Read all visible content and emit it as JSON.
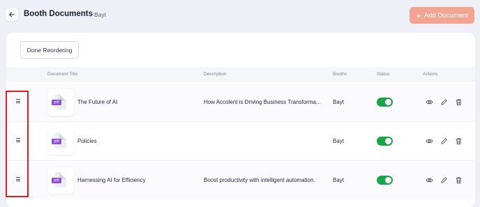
{
  "header": {
    "title": "Booth Documents",
    "separator": "|",
    "subtitle": "Bayt",
    "add_button_label": "Add Document",
    "add_button_icon": "plus-icon",
    "back_icon": "arrow-left-icon"
  },
  "toolbar": {
    "done_reordering_label": "Done Reordering"
  },
  "table": {
    "columns": [
      "Document Title",
      "Description",
      "Booths",
      "Status",
      "Actions"
    ],
    "rows": [
      {
        "title": "The Future of AI",
        "description": "How Accolent is Driving Business Transforma...",
        "booth": "Bayt",
        "status_enabled": true,
        "file_type": "pdf"
      },
      {
        "title": "Policies",
        "description": "",
        "booth": "Bayt",
        "status_enabled": true,
        "file_type": "pdf"
      },
      {
        "title": "Harnessing AI for Efficiency",
        "description": "Boost productivity with intelligent automation.",
        "booth": "Bayt",
        "status_enabled": true,
        "file_type": "pdf"
      }
    ]
  },
  "colors": {
    "accent_button": "#f3a593",
    "toggle_on": "#1aa34a",
    "pdf_tag": "#8f52d6",
    "highlight_box": "#e01c24"
  }
}
